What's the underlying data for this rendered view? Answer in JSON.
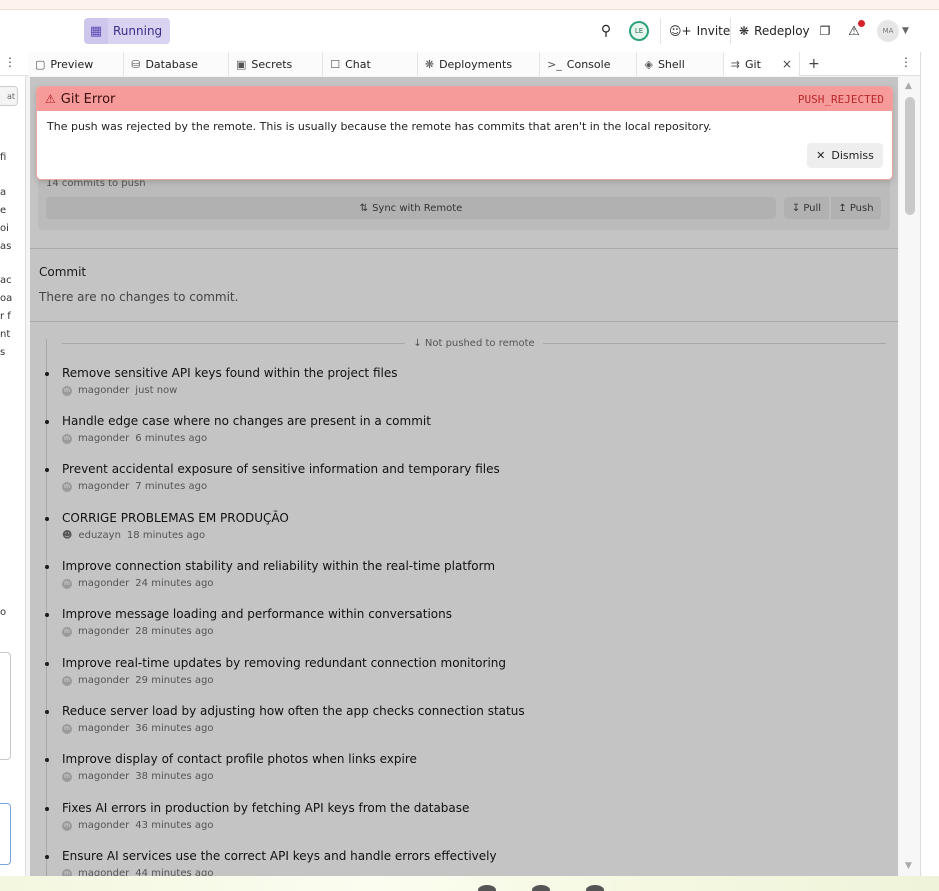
{
  "topbar": {
    "run_label": "Running",
    "avatar_user": "LE",
    "invite_label": "Invite",
    "redeploy_label": "Redeploy",
    "avatar_me": "MA"
  },
  "tabs": [
    {
      "label": "Preview",
      "icon": "preview-icon"
    },
    {
      "label": "Database",
      "icon": "database-icon"
    },
    {
      "label": "Secrets",
      "icon": "lock-icon"
    },
    {
      "label": "Chat",
      "icon": "chat-icon"
    },
    {
      "label": "Deployments",
      "icon": "deploy-icon"
    },
    {
      "label": "Console",
      "icon": "console-icon"
    },
    {
      "label": "Shell",
      "icon": "shell-icon"
    },
    {
      "label": "Git",
      "icon": "git-icon",
      "active": true
    }
  ],
  "left_panel": {
    "button_text": "at",
    "snippets": [
      "fi",
      "a",
      "e",
      "oi",
      "as",
      "ac",
      "oa",
      "r f",
      "nt",
      "s",
      "o"
    ]
  },
  "error": {
    "title": "Git Error",
    "code": "PUSH_REJECTED",
    "message": "The push was rejected by the remote. This is usually because the remote has commits that aren't in the local repository.",
    "dismiss_label": "Dismiss"
  },
  "sync": {
    "commits_to_push": "14 commits to push",
    "sync_label": "Sync with Remote",
    "pull_label": "Pull",
    "push_label": "Push"
  },
  "commit_section": {
    "title": "Commit",
    "empty_text": "There are no changes to commit."
  },
  "history": {
    "header": "Not pushed to remote",
    "commits": [
      {
        "message": "Remove sensitive API keys found within the project files",
        "author": "magonder",
        "time": "just now"
      },
      {
        "message": "Handle edge case where no changes are present in a commit",
        "author": "magonder",
        "time": "6 minutes ago"
      },
      {
        "message": "Prevent accidental exposure of sensitive information and temporary files",
        "author": "magonder",
        "time": "7 minutes ago"
      },
      {
        "message": "CORRIGE PROBLEMAS EM PRODUÇÃO",
        "author": "eduzayn",
        "time": "18 minutes ago",
        "user_icon": true
      },
      {
        "message": "Improve connection stability and reliability within the real-time platform",
        "author": "magonder",
        "time": "24 minutes ago"
      },
      {
        "message": "Improve message loading and performance within conversations",
        "author": "magonder",
        "time": "28 minutes ago"
      },
      {
        "message": "Improve real-time updates by removing redundant connection monitoring",
        "author": "magonder",
        "time": "29 minutes ago"
      },
      {
        "message": "Reduce server load by adjusting how often the app checks connection status",
        "author": "magonder",
        "time": "36 minutes ago"
      },
      {
        "message": "Improve display of contact profile photos when links expire",
        "author": "magonder",
        "time": "38 minutes ago"
      },
      {
        "message": "Fixes AI errors in production by fetching API keys from the database",
        "author": "magonder",
        "time": "43 minutes ago"
      },
      {
        "message": "Ensure AI services use the correct API keys and handle errors effectively",
        "author": "magonder",
        "time": "44 minutes ago"
      }
    ]
  },
  "colors": {
    "error_header": "#f79a9a",
    "error_code": "#b52a2a",
    "running_badge": "#d9d2f0",
    "overlay": "#c4c4c4"
  }
}
